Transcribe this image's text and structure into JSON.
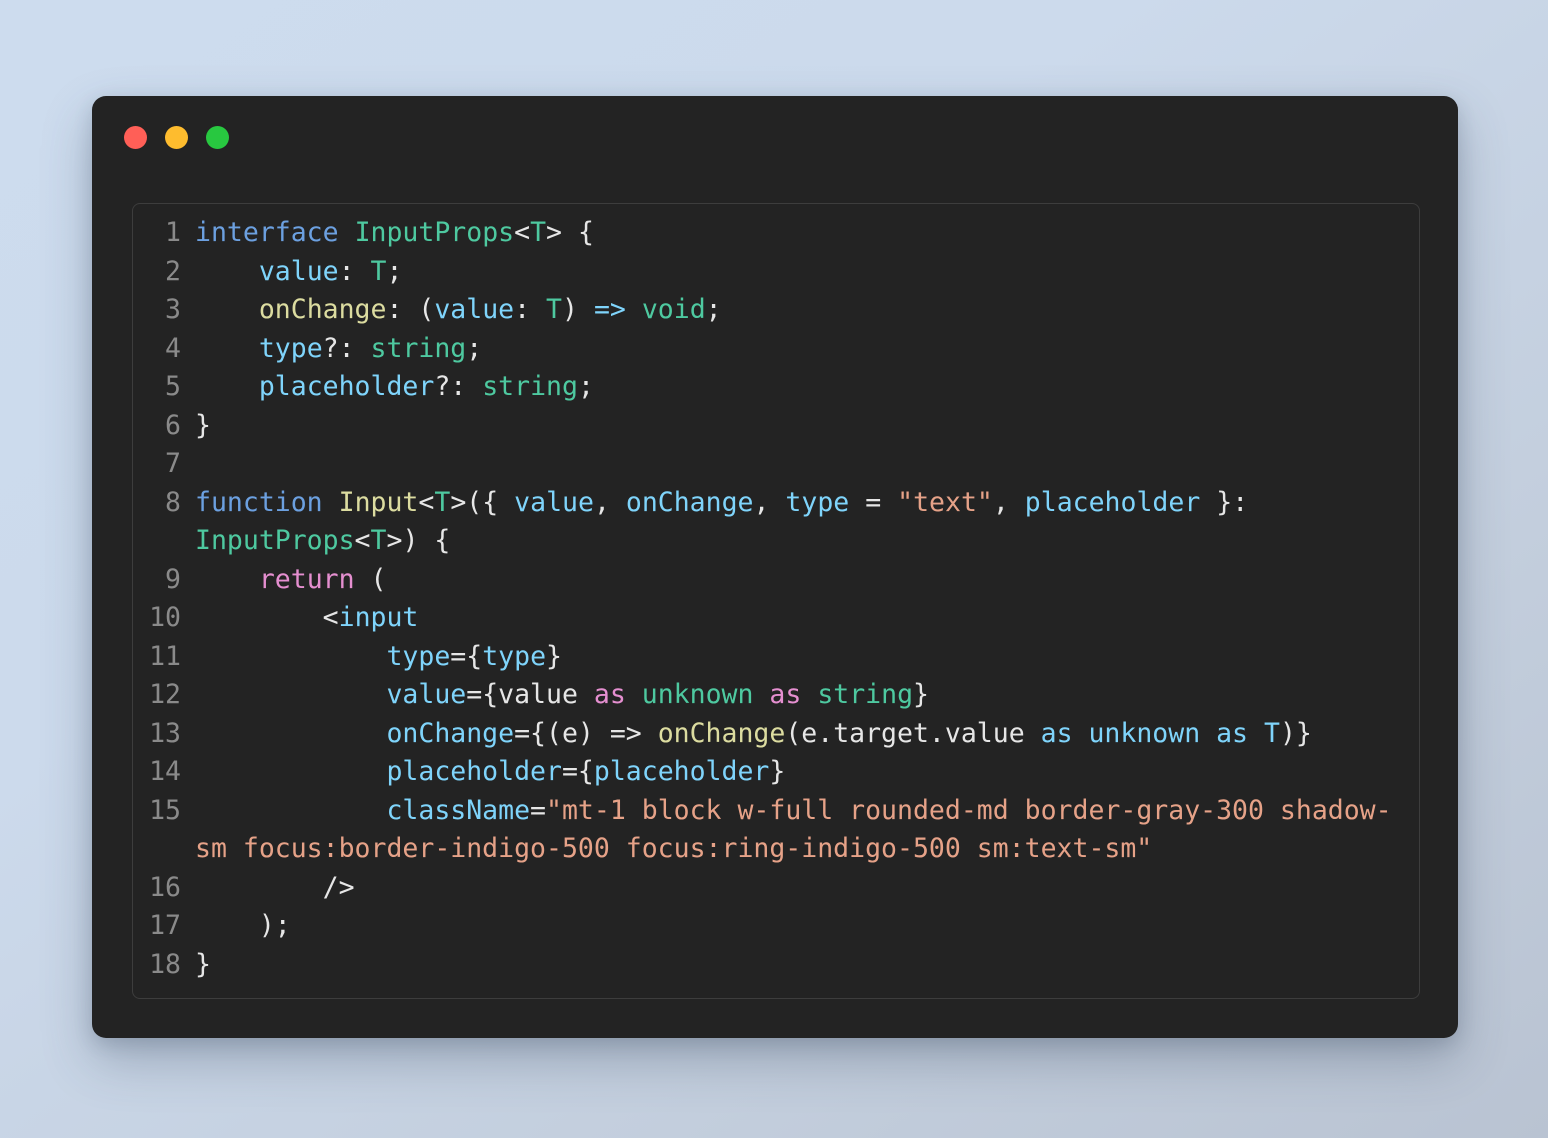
{
  "window": {
    "traffic_lights": [
      {
        "name": "close",
        "color": "#ff5f57"
      },
      {
        "name": "minimize",
        "color": "#febc2e"
      },
      {
        "name": "maximize",
        "color": "#28c840"
      }
    ]
  },
  "editor": {
    "language": "typescript-react",
    "background": "#232323",
    "gutter_color": "#8a8a8a",
    "line_count": 18,
    "line_numbers": [
      "1",
      "2",
      "3",
      "4",
      "5",
      "6",
      "7",
      "8",
      "9",
      "10",
      "11",
      "12",
      "13",
      "14",
      "15",
      "16",
      "17",
      "18"
    ],
    "lines": [
      {
        "number": "1",
        "text": "interface InputProps<T> {"
      },
      {
        "number": "2",
        "text": "    value: T;"
      },
      {
        "number": "3",
        "text": "    onChange: (value: T) => void;"
      },
      {
        "number": "4",
        "text": "    type?: string;"
      },
      {
        "number": "5",
        "text": "    placeholder?: string;"
      },
      {
        "number": "6",
        "text": "}"
      },
      {
        "number": "7",
        "text": ""
      },
      {
        "number": "8",
        "text": "function Input<T>({ value, onChange, type = \"text\", placeholder }: InputProps<T>) {"
      },
      {
        "number": "9",
        "text": "    return ("
      },
      {
        "number": "10",
        "text": "        <input"
      },
      {
        "number": "11",
        "text": "            type={type}"
      },
      {
        "number": "12",
        "text": "            value={value as unknown as string}"
      },
      {
        "number": "13",
        "text": "            onChange={(e) => onChange(e.target.value as unknown as T)}"
      },
      {
        "number": "14",
        "text": "            placeholder={placeholder}"
      },
      {
        "number": "15",
        "text": "            className=\"mt-1 block w-full rounded-md border-gray-300 shadow-sm focus:border-indigo-500 focus:ring-indigo-500 sm:text-sm\""
      },
      {
        "number": "16",
        "text": "        />"
      },
      {
        "number": "17",
        "text": "    );"
      },
      {
        "number": "18",
        "text": "}"
      }
    ],
    "tokens": {
      "keyword_color": "#6ca0e0",
      "type_color": "#4ec9a0",
      "function_color": "#dcdca0",
      "property_color": "#7fd4fb",
      "return_color": "#e58fd0",
      "string_color": "#e6a288",
      "plain_color": "#e6e6e6"
    }
  }
}
